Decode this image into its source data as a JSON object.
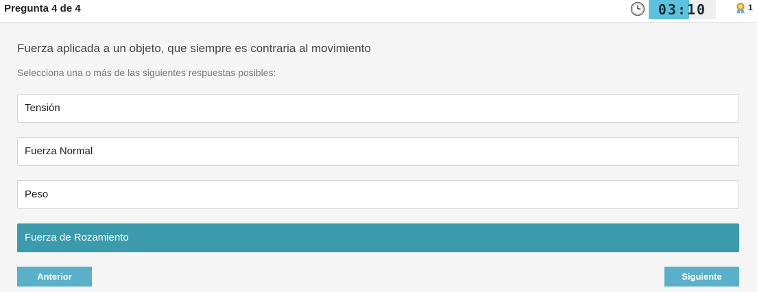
{
  "header": {
    "question_counter": "Pregunta 4 de 4",
    "timer": "03:10",
    "timer_progress_percent": 60,
    "timer_accent": "#5bc2de",
    "points": "1"
  },
  "question": {
    "text": "Fuerza aplicada a un objeto, que siempre es contraria al movimiento",
    "instructions": "Selecciona una o más de las siguientes respuestas posibles:"
  },
  "options": [
    {
      "label": "Tensión",
      "selected": false
    },
    {
      "label": "Fuerza Normal",
      "selected": false
    },
    {
      "label": "Peso",
      "selected": false
    },
    {
      "label": "Fuerza de Rozamiento",
      "selected": true
    }
  ],
  "navigation": {
    "prev_label": "Anterior",
    "next_label": "Siguiente"
  },
  "colors": {
    "selected_option": "#3c9aad",
    "nav_button": "#5ab0cb"
  },
  "icons": [
    "clock-icon",
    "medal-icon"
  ]
}
